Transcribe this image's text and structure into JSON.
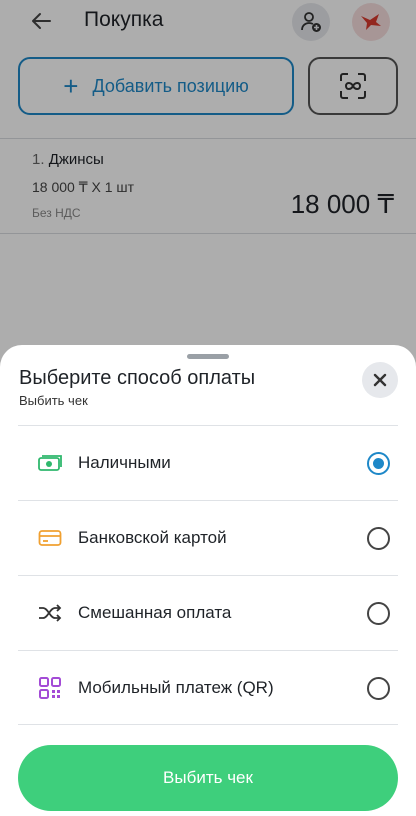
{
  "header": {
    "title": "Покупка"
  },
  "actions": {
    "add_position": "Добавить позицию"
  },
  "item": {
    "index": "1.",
    "name": "Джинсы",
    "qty_line": "18 000 ₸ X 1 шт",
    "vat": "Без НДС",
    "total": "18 000 ₸"
  },
  "sheet": {
    "title": "Выберите способ оплаты",
    "subtitle": "Выбить чек",
    "options": [
      {
        "label": "Наличными",
        "icon": "cash-icon",
        "selected": true
      },
      {
        "label": "Банковской картой",
        "icon": "bank-card-icon",
        "selected": false
      },
      {
        "label": "Смешанная оплата",
        "icon": "shuffle-icon",
        "selected": false
      },
      {
        "label": "Мобильный платеж (QR)",
        "icon": "qr-code-icon",
        "selected": false
      }
    ],
    "confirm_label": "Выбить чек"
  },
  "colors": {
    "accent": "#1e88c8",
    "primary_button": "#3ecf7c",
    "cash_icon": "#2fb86d",
    "card_icon": "#f0a030",
    "qr_icon": "#a34bd6"
  }
}
